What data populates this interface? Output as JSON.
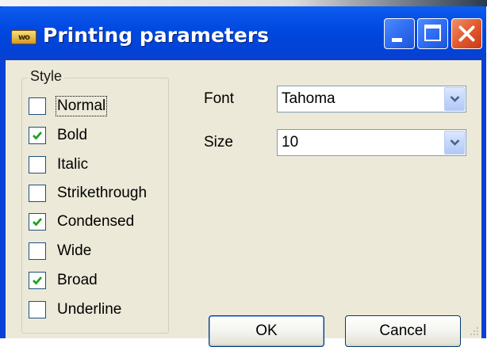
{
  "window": {
    "title": "Printing parameters",
    "app_icon_text": "wo",
    "colors": {
      "titlebar": "#0048e0",
      "client": "#ece9d8",
      "close_button": "#e25a2e",
      "checkmark": "#21a121"
    }
  },
  "style_group": {
    "legend": "Style",
    "options": [
      {
        "label": "Normal",
        "checked": false,
        "focused": true
      },
      {
        "label": "Bold",
        "checked": true,
        "focused": false
      },
      {
        "label": "Italic",
        "checked": false,
        "focused": false
      },
      {
        "label": "Strikethrough",
        "checked": false,
        "focused": false
      },
      {
        "label": "Condensed",
        "checked": true,
        "focused": false
      },
      {
        "label": "Wide",
        "checked": false,
        "focused": false
      },
      {
        "label": "Broad",
        "checked": true,
        "focused": false
      },
      {
        "label": "Underline",
        "checked": false,
        "focused": false
      }
    ]
  },
  "font": {
    "label": "Font",
    "value": "Tahoma"
  },
  "size": {
    "label": "Size",
    "value": "10"
  },
  "buttons": {
    "ok": "OK",
    "cancel": "Cancel"
  },
  "icons": [
    "app-icon",
    "minimize-icon",
    "maximize-icon",
    "close-icon",
    "chevron-down-icon",
    "checkmark-icon",
    "resize-grip-icon"
  ]
}
